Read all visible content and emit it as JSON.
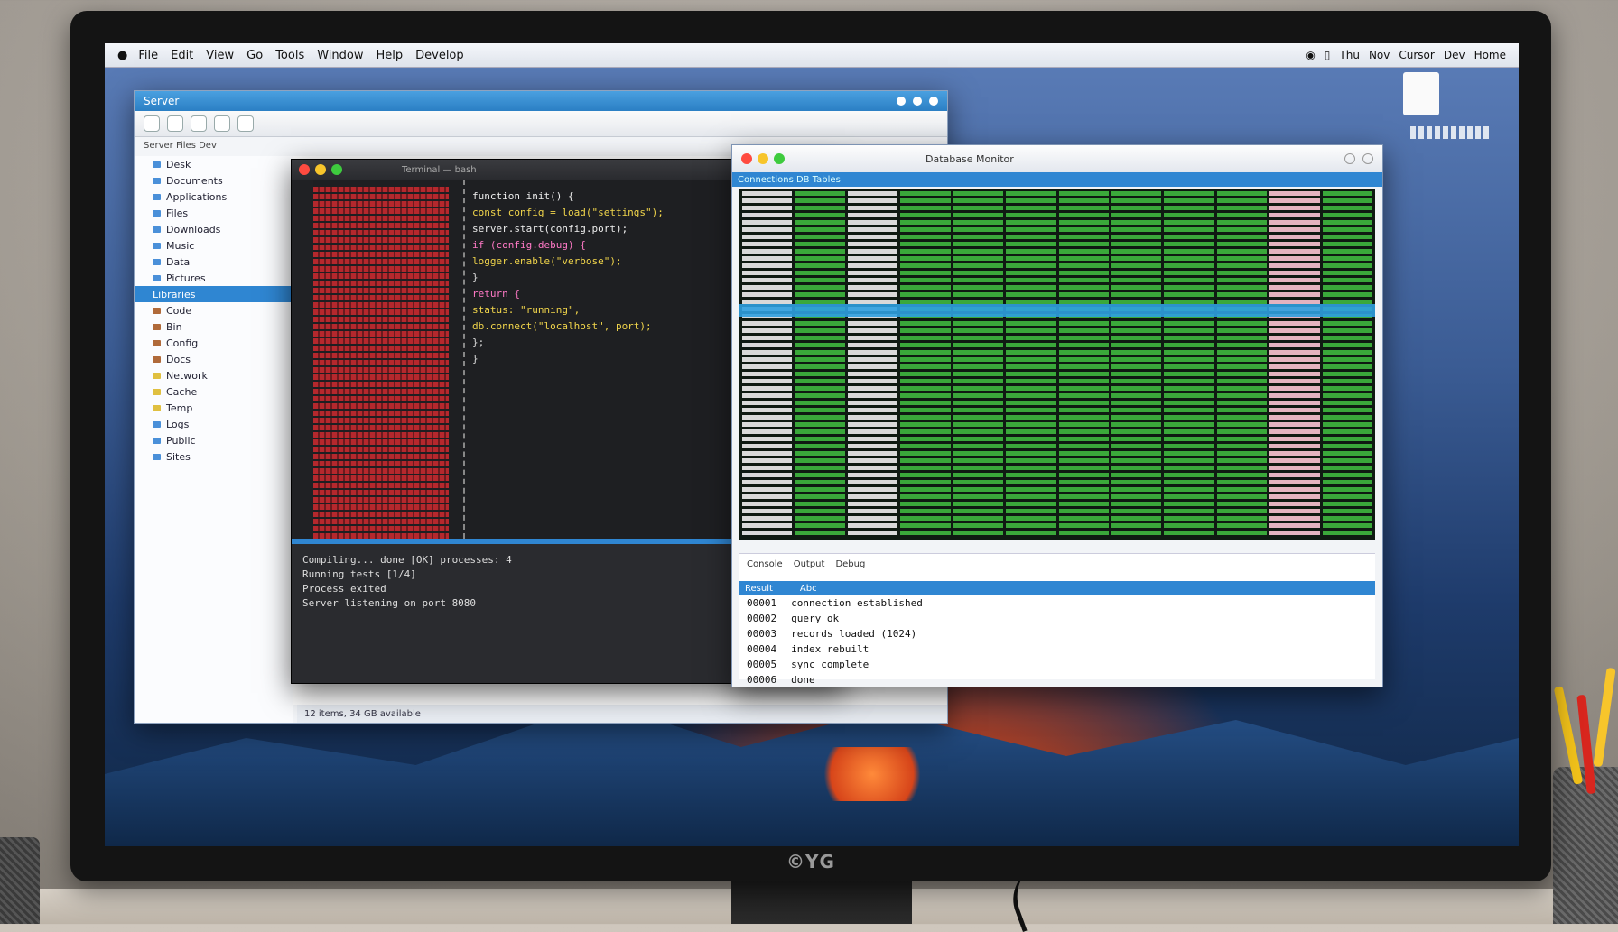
{
  "monitor": {
    "brand": "©YG"
  },
  "menubar": {
    "items": [
      "File",
      "Edit",
      "View",
      "Go",
      "Tools",
      "Window",
      "Help",
      "Develop"
    ],
    "status": [
      "Thu",
      "Nov",
      "Cursor",
      "Dev",
      "Home"
    ]
  },
  "finder": {
    "title": "Server",
    "path": "Server  Files  Dev",
    "sidebar_top": [
      "Desk",
      "Documents",
      "Applications",
      "Files",
      "Downloads",
      "Music",
      "Data",
      "Pictures"
    ],
    "section": "Libraries",
    "sidebar_bottom": [
      "Code",
      "Bin",
      "Config",
      "Docs",
      "Network",
      "Cache",
      "Temp",
      "Logs",
      "Public",
      "Sites"
    ],
    "status": "12 items, 34 GB available"
  },
  "editor": {
    "title": "Terminal — bash",
    "code_lines": [
      "function init() {",
      "  const config = load(\"settings\");",
      "  server.start(config.port);",
      "",
      "  if (config.debug) {",
      "    logger.enable(\"verbose\");",
      "  }",
      "",
      "  return {",
      "    status: \"running\",",
      "    db.connect(\"localhost\", port);",
      "  };",
      "}"
    ],
    "terminal_lines": [
      "Compiling... done  [OK]  processes: 4",
      "Running tests [1/4]",
      "Process exited",
      "",
      "Server listening on port 8080"
    ]
  },
  "datawin": {
    "title": "Database Monitor",
    "header": "Connections  DB  Tables",
    "tabs": [
      "Console",
      "Output",
      "Debug"
    ],
    "bar_labels": [
      "Result",
      "Abc"
    ],
    "rows": [
      [
        "00001",
        "connection established"
      ],
      [
        "00002",
        "query ok"
      ],
      [
        "00003",
        "records loaded (1024)"
      ],
      [
        "00004",
        "index rebuilt"
      ],
      [
        "00005",
        "sync complete"
      ],
      [
        "00006",
        "done"
      ]
    ]
  }
}
